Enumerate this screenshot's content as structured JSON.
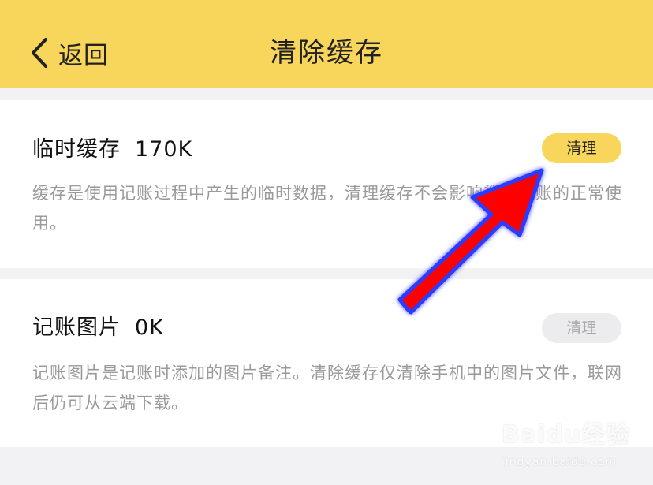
{
  "header": {
    "back_label": "返回",
    "title": "清除缓存",
    "background_color": "#f8d55b"
  },
  "cards": [
    {
      "title": "临时缓存",
      "size": "170K",
      "button_label": "清理",
      "button_state": "enabled",
      "description": "缓存是使用记账过程中产生的临时数据，清理缓存不会影响鲨鱼记账的正常使用。"
    },
    {
      "title": "记账图片",
      "size": "0K",
      "button_label": "清理",
      "button_state": "disabled",
      "description": "记账图片是记账时添加的图片备注。清除缓存仅清除手机中的图片文件，联网后仍可从云端下载。"
    }
  ],
  "annotation": {
    "arrow_color": "#ff0000",
    "arrow_glow": "#2a3cff"
  },
  "watermark": {
    "brand": "Baidu经验",
    "url": "jingyan.baidu.com"
  },
  "colors": {
    "accent": "#f8d55b",
    "page_bg": "#f2f2f4",
    "muted_text": "#9a9a9a"
  }
}
